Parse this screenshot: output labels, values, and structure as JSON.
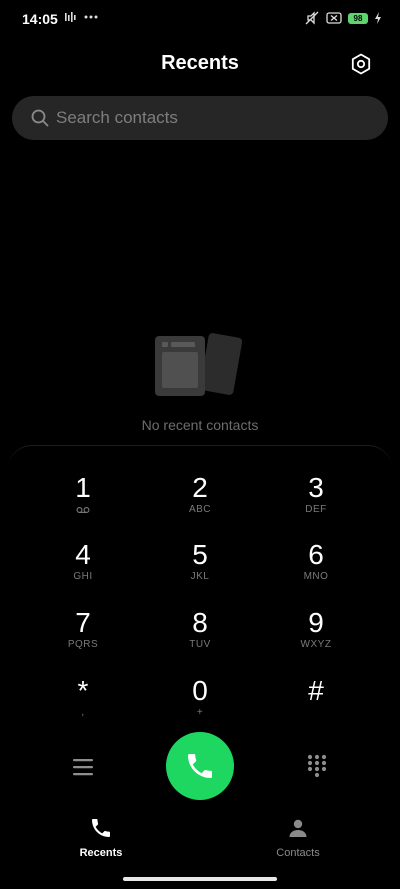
{
  "status_bar": {
    "time": "14:05",
    "battery": "98",
    "left_icons": [
      "signal-activity-icon",
      "more-dots-icon"
    ],
    "right_icons": [
      "mute-vibrate-icon",
      "sim-off-icon",
      "battery-icon",
      "charging-icon"
    ]
  },
  "header": {
    "title": "Recents",
    "settings_icon": "settings-hexagon-icon"
  },
  "search": {
    "placeholder": "Search contacts"
  },
  "empty_state": {
    "message": "No recent contacts"
  },
  "dialpad": {
    "keys": [
      {
        "digit": "1",
        "letters": ""
      },
      {
        "digit": "2",
        "letters": "ABC"
      },
      {
        "digit": "3",
        "letters": "DEF"
      },
      {
        "digit": "4",
        "letters": "GHI"
      },
      {
        "digit": "5",
        "letters": "JKL"
      },
      {
        "digit": "6",
        "letters": "MNO"
      },
      {
        "digit": "7",
        "letters": "PQRS"
      },
      {
        "digit": "8",
        "letters": "TUV"
      },
      {
        "digit": "9",
        "letters": "WXYZ"
      },
      {
        "digit": "*",
        "letters": ","
      },
      {
        "digit": "0",
        "letters": "+"
      },
      {
        "digit": "#",
        "letters": ""
      }
    ]
  },
  "actions": {
    "call_color": "#1ed760"
  },
  "bottom_nav": {
    "items": [
      {
        "label": "Recents",
        "icon": "phone-icon",
        "active": true
      },
      {
        "label": "Contacts",
        "icon": "person-icon",
        "active": false
      }
    ]
  }
}
